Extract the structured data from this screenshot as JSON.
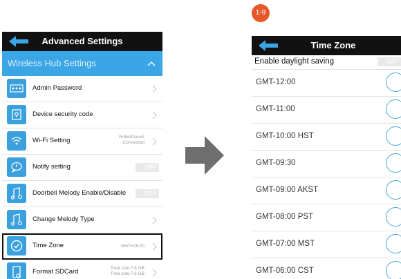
{
  "step_badge": "1-9",
  "left": {
    "title": "Advanced Settings",
    "section": "Wireless Hub Settings",
    "rows": [
      {
        "label": "Admin Password",
        "icon": "dots-icon"
      },
      {
        "label": "Device security code",
        "icon": "lock-icon"
      },
      {
        "label": "Wi-Fi Setting",
        "icon": "wifi-icon",
        "value_line1": "RobertGuest",
        "value_line2": "Connected"
      },
      {
        "label": "Notify setting",
        "icon": "chat-bubble-icon",
        "toggle": "OFF"
      },
      {
        "label": "Doorbell Melody Enable/Disable",
        "icon": "music-note-gear-icon",
        "toggle": "OFF"
      },
      {
        "label": "Change Melody Type",
        "icon": "music-note-gear-icon"
      },
      {
        "label": "Time Zone",
        "icon": "check-circle-icon",
        "value": "GMT+08:00"
      },
      {
        "label": "Format SDCard",
        "icon": "sdcard-icon",
        "value_line1": "Total size:7.6 GB",
        "value_line2": "Free size:7.6 GB"
      }
    ]
  },
  "right": {
    "title": "Time Zone",
    "dst_label": "Enable daylight saving",
    "dst_toggle": "OFF",
    "zones": [
      "GMT-12:00",
      "GMT-11:00",
      "GMT-10:00 HST",
      "GMT-09:30",
      "GMT-09:00 AKST",
      "GMT-08:00 PST",
      "GMT-07:00 MST",
      "GMT-06:00 CST"
    ]
  },
  "colors": {
    "accent": "#3aa0de",
    "section": "#3ba6e6",
    "badge": "#e8572a",
    "header": "#111111",
    "arrow": "#6e6e6e"
  }
}
